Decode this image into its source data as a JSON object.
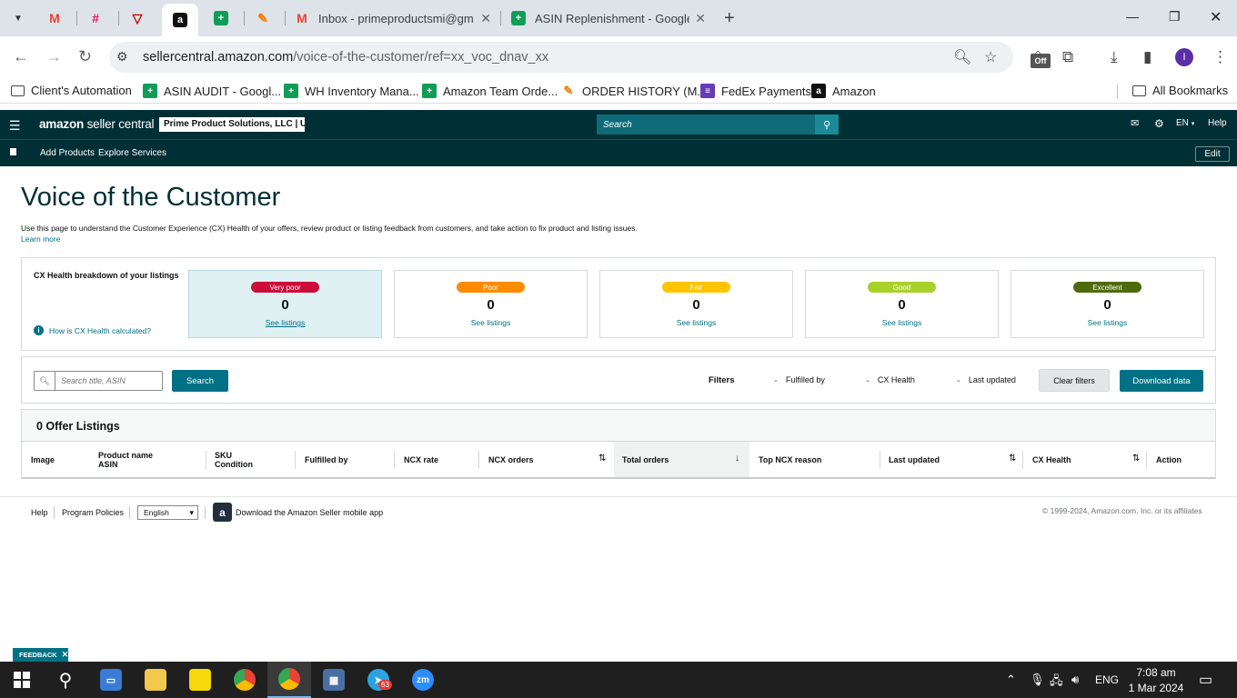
{
  "browser": {
    "tabs": [
      {
        "title": "",
        "icon": "gmail-icon"
      },
      {
        "title": "",
        "icon": "slack-icon"
      },
      {
        "title": "",
        "icon": "red-v-icon"
      },
      {
        "title": "",
        "icon": "amazon-icon",
        "active": true
      },
      {
        "title": "",
        "icon": "sheets-icon"
      },
      {
        "title": "",
        "icon": "clickup-icon"
      },
      {
        "title": "Inbox - primeproductsmi@gma",
        "icon": "gmail-icon"
      },
      {
        "title": "ASIN Replenishment - Google S",
        "icon": "sheets-icon"
      }
    ],
    "url_host": "sellercentral.amazon.com",
    "url_path": "/voice-of-the-customer/ref=xx_voc_dnav_xx",
    "profile_initial": "I",
    "off_badge": "Off",
    "bookmarks": [
      {
        "label": "Client's Automation",
        "icon": "folder-icon"
      },
      {
        "label": "ASIN AUDIT - Googl...",
        "icon": "sheets-icon"
      },
      {
        "label": "WH Inventory Mana...",
        "icon": "sheets-icon"
      },
      {
        "label": "Amazon Team Orde...",
        "icon": "sheets-icon"
      },
      {
        "label": "ORDER HISTORY (M...",
        "icon": "clickup-icon"
      },
      {
        "label": "FedEx Payments",
        "icon": "forms-icon"
      },
      {
        "label": "Amazon",
        "icon": "amazon-icon"
      }
    ],
    "all_bookmarks": "All Bookmarks"
  },
  "sc": {
    "logo_a": "amazon",
    "logo_b": "seller central",
    "account": "Prime Product Solutions, LLC | U...",
    "search_placeholder": "Search",
    "lang": "EN",
    "help": "Help",
    "nav": [
      "Add Products",
      "Explore Services"
    ],
    "edit": "Edit"
  },
  "page": {
    "title": "Voice of the Customer",
    "description": "Use this page to understand the Customer Experience (CX) Health of your offers, review product or listing feedback from customers, and take action to fix product and listing issues.",
    "learn_more": "Learn more"
  },
  "health": {
    "label": "CX Health breakdown of your listings",
    "how": "How is CX Health calculated?",
    "cards": [
      {
        "label": "Very poor",
        "count": "0",
        "link": "See listings",
        "color": "#cc0c39"
      },
      {
        "label": "Poor",
        "count": "0",
        "link": "See listings",
        "color": "#ff8c00"
      },
      {
        "label": "Fair",
        "count": "0",
        "link": "See listings",
        "color": "#ffc400"
      },
      {
        "label": "Good",
        "count": "0",
        "link": "See listings",
        "color": "#a8d12a"
      },
      {
        "label": "Excellent",
        "count": "0",
        "link": "See listings",
        "color": "#4d6b0c"
      }
    ]
  },
  "filters": {
    "search_placeholder": "Search title, ASIN",
    "search_btn": "Search",
    "label": "Filters",
    "dropdowns": [
      "Fulfilled by",
      "CX Health",
      "Last updated"
    ],
    "clear": "Clear filters",
    "download": "Download data"
  },
  "listings": {
    "title": "0 Offer Listings",
    "columns": [
      {
        "l1": "Image",
        "l2": ""
      },
      {
        "l1": "Product name",
        "l2": "ASIN"
      },
      {
        "l1": "SKU",
        "l2": "Condition"
      },
      {
        "l1": "Fulfilled by",
        "l2": ""
      },
      {
        "l1": "NCX rate",
        "l2": ""
      },
      {
        "l1": "NCX orders",
        "l2": ""
      },
      {
        "l1": "Total orders",
        "l2": ""
      },
      {
        "l1": "Top NCX reason",
        "l2": ""
      },
      {
        "l1": "Last updated",
        "l2": ""
      },
      {
        "l1": "CX Health",
        "l2": ""
      },
      {
        "l1": "Action",
        "l2": ""
      }
    ]
  },
  "footer": {
    "help": "Help",
    "policies": "Program Policies",
    "language": "English",
    "app": "Download the Amazon Seller mobile app",
    "copyright": "© 1999-2024, Amazon.com, Inc. or its affiliates"
  },
  "feedback": "FEEDBACK",
  "taskbar": {
    "lang": "ENG",
    "time": "7:08 am",
    "date": "1 Mar 2024",
    "telegram_badge": "63"
  }
}
